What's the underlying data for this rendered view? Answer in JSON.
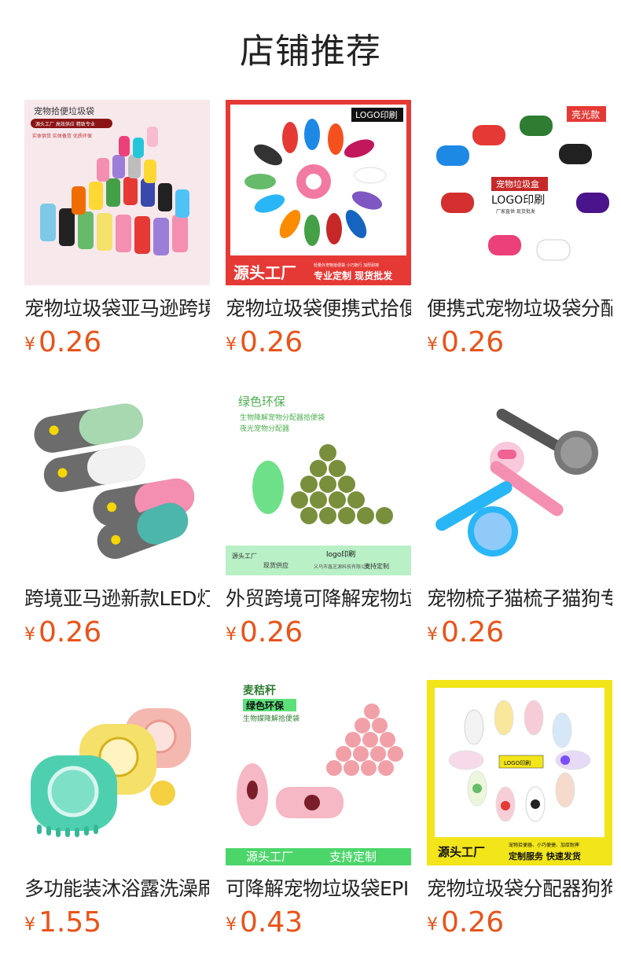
{
  "section": {
    "title": "店铺推荐"
  },
  "colors": {
    "price": "#e8541a",
    "title": "#222222"
  },
  "products": [
    {
      "name": "宠物垃圾袋亚马逊跨境",
      "currency": "¥",
      "price": "0.26",
      "image_text": {
        "headline": "宠物拾便垃圾袋",
        "line1": "源头工厂  高效供应  精致专业",
        "line2": "实体供货  实体备货  优质环保"
      }
    },
    {
      "name": "宠物垃圾袋便携式拾便",
      "currency": "¥",
      "price": "0.26",
      "image_text": {
        "badge": "LOGO印刷",
        "banner_left": "源头工厂",
        "banner_small": "轻量外宠物拾便袋 小巧随行 加厚耐摔",
        "banner_right": "专业定制  现货批发"
      }
    },
    {
      "name": "便携式宠物垃圾袋分配器",
      "currency": "¥",
      "price": "0.26",
      "image_text": {
        "badge": "亮光款",
        "label": "宠物垃圾盒",
        "logo": "LOGO印刷",
        "sub": "厂家直供  现货批发"
      }
    },
    {
      "name": "跨境亚马逊新款LED灯",
      "currency": "¥",
      "price": "0.26",
      "image_text": {}
    },
    {
      "name": "外贸跨境可降解宠物垃圾",
      "currency": "¥",
      "price": "0.26",
      "image_text": {
        "headline": "绿色环保",
        "line1": "生物降解宠物分配器拾便袋",
        "line2": "夜光宠物分配器",
        "footer_left": "源头工厂",
        "footer_left2": "现货供应",
        "footer_mid": "logo印刷",
        "footer_right": "支持定制",
        "footer_small": "义乌市鑫芝源科技有限公司"
      }
    },
    {
      "name": "宠物梳子猫梳子猫狗专用",
      "currency": "¥",
      "price": "0.26",
      "image_text": {}
    },
    {
      "name": "多功能装沐浴露洗澡刷",
      "currency": "¥",
      "price": "1.55",
      "image_text": {}
    },
    {
      "name": "可降解宠物垃圾袋EPI",
      "currency": "¥",
      "price": "0.43",
      "image_text": {
        "headline": "麦秸秆",
        "line1": "绿色环保",
        "line2": "生物媒降解拾便袋",
        "footer_left": "源头工厂",
        "footer_right": "支持定制"
      }
    },
    {
      "name": "宠物垃圾袋分配器狗狗",
      "currency": "¥",
      "price": "0.26",
      "image_text": {
        "label": "LOGO印刷",
        "footer_left": "源头工厂",
        "footer_small": "宠物拾便器、小巧便捷、加厚耐摔",
        "footer_right": "定制服务  快速发货"
      }
    }
  ]
}
